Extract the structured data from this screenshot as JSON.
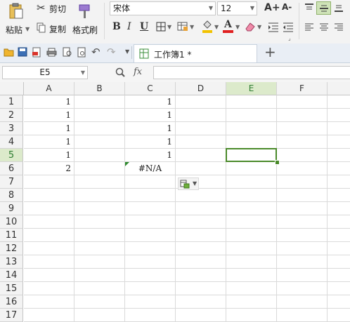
{
  "ribbon": {
    "paste_label": "粘贴",
    "cut_label": "剪切",
    "copy_label": "复制",
    "format_painter_label": "格式刷",
    "font_name": "宋体",
    "font_size": "12",
    "bold": "B",
    "italic": "I",
    "underline": "U",
    "grow_font": "A+",
    "shrink_font": "A-",
    "font_color_letter": "A"
  },
  "quickbar": {
    "tab_title": "工作簿1 *"
  },
  "formula_bar": {
    "name_box": "E5",
    "fx": "fx",
    "formula_value": ""
  },
  "sheet": {
    "columns": [
      "A",
      "B",
      "C",
      "D",
      "E",
      "F"
    ],
    "rows": [
      "1",
      "2",
      "3",
      "4",
      "5",
      "6",
      "7",
      "8",
      "9",
      "10",
      "11",
      "12",
      "13",
      "14",
      "15",
      "16",
      "17"
    ],
    "active_cell": "E5",
    "cells": {
      "A1": "1",
      "A2": "1",
      "A3": "1",
      "A4": "1",
      "A5": "1",
      "A6": "2",
      "C1": "1",
      "C2": "1",
      "C3": "1",
      "C4": "1",
      "C5": "1",
      "C6": "#N/A"
    }
  },
  "colors": {
    "accent_green": "#2e7d32",
    "selection_green": "#4a8a2a",
    "header_active": "#dceacb"
  }
}
